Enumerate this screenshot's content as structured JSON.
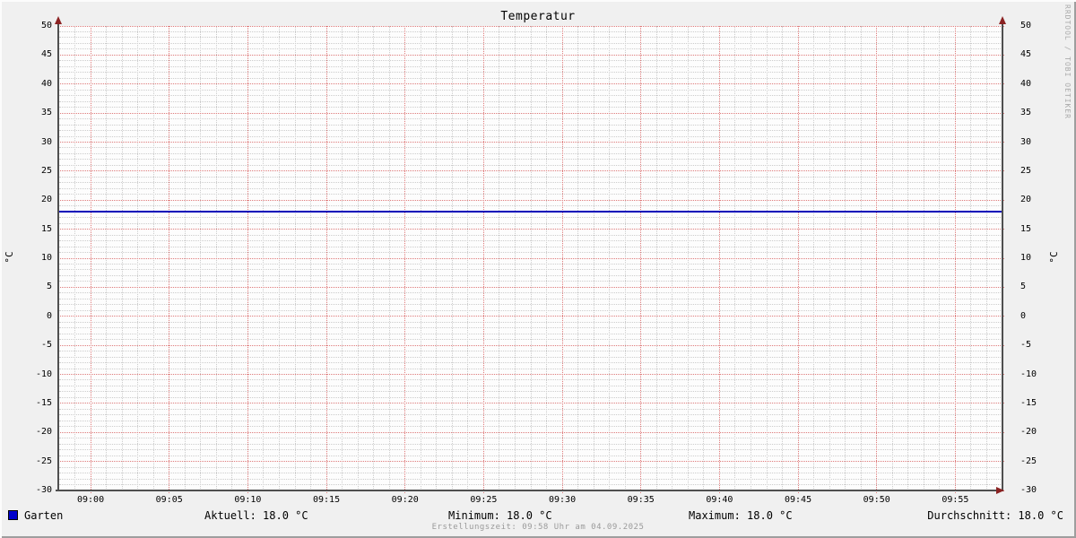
{
  "title": "Temperatur",
  "watermark": "RRDTOOL / TOBI OETIKER",
  "axis_units": {
    "left": "°C",
    "right": "°C"
  },
  "footer": {
    "legend": {
      "label": "Garten",
      "color": "#0000cc"
    },
    "stats": [
      {
        "name": "aktuell",
        "text": "Aktuell: 18.0 °C"
      },
      {
        "name": "minimum",
        "text": "Minimum: 18.0 °C"
      },
      {
        "name": "maximum",
        "text": "Maximum: 18.0 °C"
      },
      {
        "name": "durchschnitt",
        "text": "Durchschnitt: 18.0 °C"
      }
    ],
    "creation": "Erstellungszeit: 09:58 Uhr am 04.09.2025"
  },
  "chart_data": {
    "type": "line",
    "title": "Temperatur",
    "ylabel": "°C",
    "ylim": [
      -30,
      50
    ],
    "y_tick_step_major": 5,
    "y_tick_step_minor": 1,
    "y_ticks": [
      50,
      45,
      40,
      35,
      30,
      25,
      20,
      15,
      10,
      5,
      0,
      -5,
      -10,
      -15,
      -20,
      -25,
      -30
    ],
    "x_start": "08:58",
    "x_end": "09:58",
    "x_tick_step_major_minutes": 5,
    "x_tick_step_minor_minutes": 1,
    "x_ticks": [
      "09:00",
      "09:05",
      "09:10",
      "09:15",
      "09:20",
      "09:25",
      "09:30",
      "09:35",
      "09:40",
      "09:45",
      "09:50",
      "09:55"
    ],
    "grid": {
      "minor_color": "#cccccc",
      "major_color": "#de7a7a",
      "grid_on": true
    },
    "series": [
      {
        "name": "Garten",
        "color": "#0000b8",
        "x": [
          "08:58",
          "09:58"
        ],
        "y": [
          18.0,
          18.0
        ],
        "stats": {
          "aktuell": 18.0,
          "minimum": 18.0,
          "maximum": 18.0,
          "durchschnitt": 18.0
        }
      }
    ],
    "legend_position": "bottom-left"
  }
}
